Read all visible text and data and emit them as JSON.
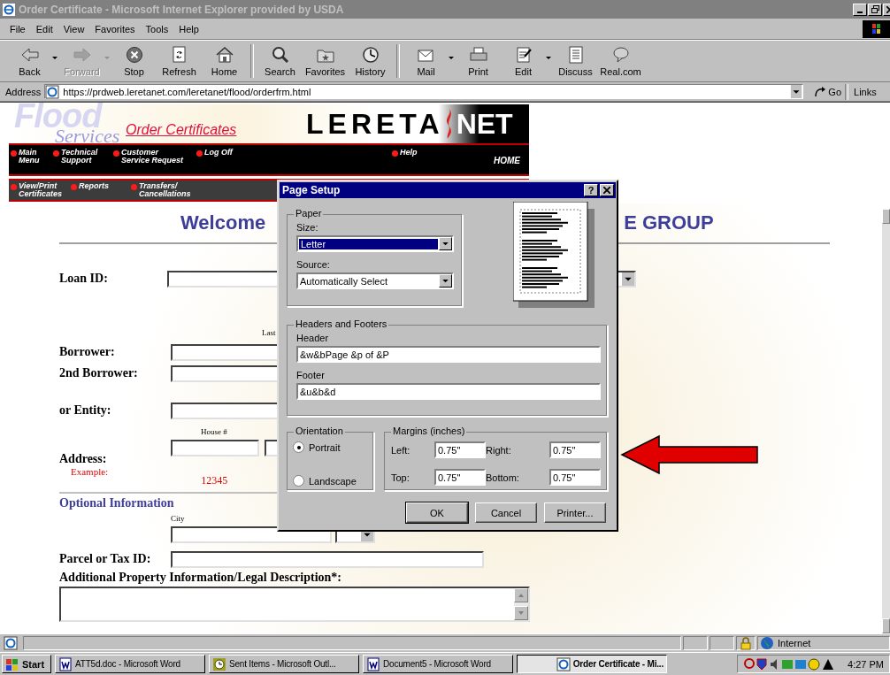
{
  "window": {
    "title": "Order Certificate - Microsoft Internet Explorer provided by USDA",
    "active": false
  },
  "menu": [
    "File",
    "Edit",
    "View",
    "Favorites",
    "Tools",
    "Help"
  ],
  "toolbar": [
    [
      {
        "label": "Back",
        "disabled": false,
        "dropdown": true
      },
      {
        "label": "Forward",
        "disabled": true,
        "dropdown": true
      },
      {
        "label": "Stop",
        "disabled": false,
        "dropdown": false
      },
      {
        "label": "Refresh",
        "disabled": false,
        "dropdown": false
      },
      {
        "label": "Home",
        "disabled": false,
        "dropdown": false
      }
    ],
    [
      {
        "label": "Search",
        "disabled": false,
        "dropdown": false
      },
      {
        "label": "Favorites",
        "disabled": false,
        "dropdown": false
      },
      {
        "label": "History",
        "disabled": false,
        "dropdown": false
      }
    ],
    [
      {
        "label": "Mail",
        "disabled": false,
        "dropdown": true
      },
      {
        "label": "Print",
        "disabled": false,
        "dropdown": false
      },
      {
        "label": "Edit",
        "disabled": false,
        "dropdown": true
      },
      {
        "label": "Discuss",
        "disabled": false,
        "dropdown": false
      },
      {
        "label": "Real.com",
        "disabled": false,
        "dropdown": false
      }
    ]
  ],
  "address": {
    "label": "Address",
    "url": "https://prdweb.leretanet.com/leretanet/flood/orderfrm.html",
    "go": "Go",
    "links": "Links"
  },
  "header": {
    "logo_top": "Flood",
    "logo_bottom": "Services",
    "title": "Order Certificates",
    "brand_left": "LERETA",
    "brand_right": "NET",
    "home": "HOME",
    "help": "Help",
    "nav": [
      "Main\nMenu",
      "Technical\nSupport",
      "Customer\nService Request",
      "Log Off"
    ],
    "nav2": [
      "View/Print\nCertificates",
      "Reports",
      "Transfers/\nCancellations"
    ]
  },
  "form": {
    "title_left": "Welcome",
    "title_right": "E GROUP",
    "loan": "Loan ID:",
    "last_hint": "Last",
    "borrower": "Borrower:",
    "second_borrower": "2nd Borrower:",
    "entity": "or Entity:",
    "house_hint": "House #",
    "address": "Address:",
    "example_label": "Example:",
    "example_house": "12345",
    "optional": "Optional Information",
    "city_hint": "City",
    "parcel": "Parcel or Tax ID:",
    "additional": "Additional Property Information/Legal Description*:"
  },
  "dialog": {
    "title": "Page Setup",
    "help": "?",
    "paper": {
      "legend": "Paper",
      "size_label": "Size:",
      "size": "Letter",
      "source_label": "Source:",
      "source": "Automatically Select"
    },
    "headers": {
      "legend": "Headers and Footers",
      "header_label": "Header",
      "header": "&w&bPage &p of &P",
      "footer_label": "Footer",
      "footer": "&u&b&d"
    },
    "orientation": {
      "legend": "Orientation",
      "options": [
        {
          "label": "Portrait",
          "selected": true
        },
        {
          "label": "Landscape",
          "selected": false
        }
      ]
    },
    "margins": {
      "legend": "Margins (inches)",
      "fields": [
        {
          "label": "Left:",
          "value": "0.75\""
        },
        {
          "label": "Right:",
          "value": "0.75\""
        },
        {
          "label": "Top:",
          "value": "0.75\""
        },
        {
          "label": "Bottom:",
          "value": "0.75\""
        }
      ]
    },
    "buttons": [
      {
        "label": "OK",
        "default": true
      },
      {
        "label": "Cancel",
        "default": false
      },
      {
        "label": "Printer...",
        "default": false
      }
    ]
  },
  "status_bar": {
    "zone": "Internet",
    "secure": true
  },
  "taskbar": {
    "start": "Start",
    "tasks": [
      {
        "label": "ATT5d.doc - Microsoft Word",
        "selected": false
      },
      {
        "label": "Sent Items - Microsoft Outl...",
        "selected": false
      },
      {
        "label": "Document5 - Microsoft Word",
        "selected": false
      },
      {
        "label": "Order Certificate - Mi...",
        "selected": true
      }
    ],
    "clock": "4:27 PM"
  }
}
